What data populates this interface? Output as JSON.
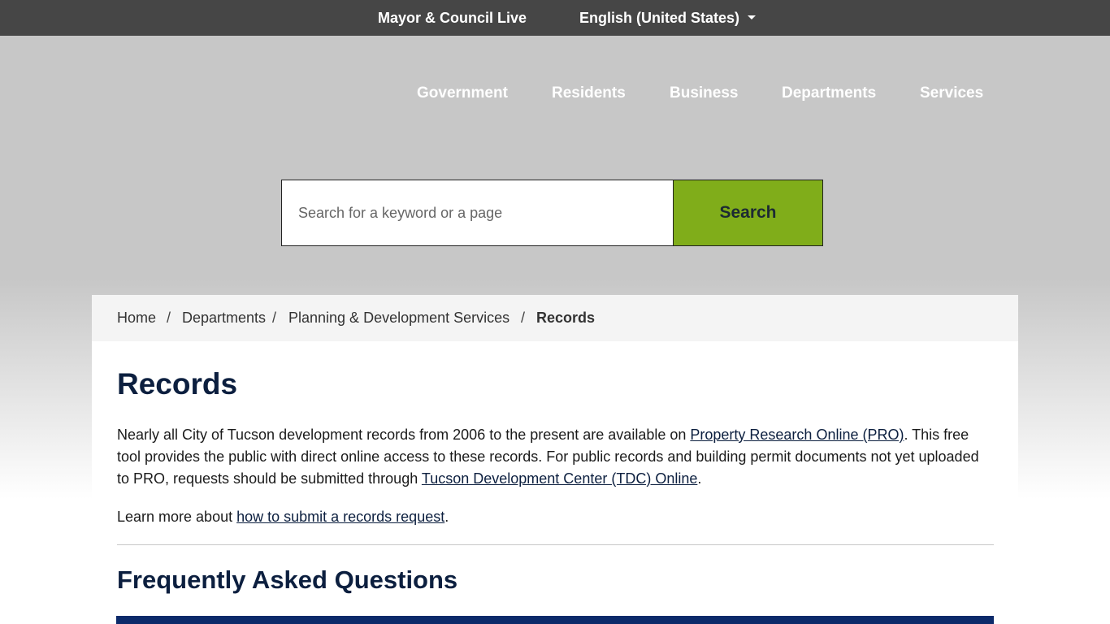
{
  "topbar": {
    "live_link": "Mayor & Council Live",
    "language": "English (United States)"
  },
  "nav": {
    "items": [
      "Government",
      "Residents",
      "Business",
      "Departments",
      "Services"
    ]
  },
  "search": {
    "placeholder": "Search for a keyword or a page",
    "button": "Search"
  },
  "breadcrumb": {
    "items": [
      "Home",
      "Departments",
      "Planning & Development Services"
    ],
    "separator": "/",
    "current": "Records"
  },
  "page": {
    "title": "Records",
    "p1_a": "Nearly all City of Tucson development records from 2006 to the present are available on ",
    "p1_link1": "Property Research Online (PRO)",
    "p1_b": ". This free tool provides the public with direct online access to these records. For public records and building permit documents not yet uploaded to PRO, requests should be submitted through ",
    "p1_link2": "Tucson Development Center (TDC) Online",
    "p1_c": ".",
    "p2_a": "Learn more about ",
    "p2_link": "how to submit a records request",
    "p2_b": ".",
    "faq_title": "Frequently Asked Questions"
  },
  "colors": {
    "topbar": "#464646",
    "hero": "#c7c7c7",
    "search_button": "#80ad1a",
    "heading": "#0c1f3f",
    "faq_bar": "#0c2a6a"
  },
  "icons": {
    "language_caret": "chevron-down-icon"
  }
}
